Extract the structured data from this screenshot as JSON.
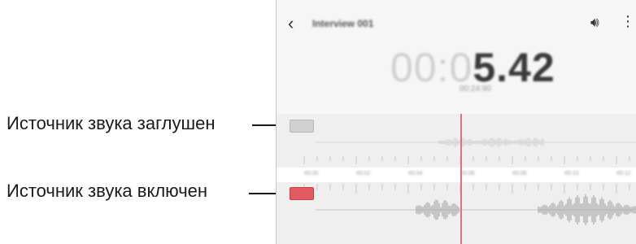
{
  "callouts": {
    "muted": "Источник звука заглушен",
    "enabled": "Источник звука включен"
  },
  "recorder": {
    "title": "Interview 001",
    "back_icon": "chevron-left-icon",
    "volume_icon": "speaker-icon",
    "more_icon": "more-vertical-icon",
    "elapsed_dim": "00:0",
    "elapsed_strong": "5.42",
    "total_time": "00:24:90",
    "timeline_marks": [
      "00:00",
      "00:02",
      "00:04",
      "00:06",
      "00:08",
      "00:10",
      "00:12"
    ],
    "colors": {
      "track_enabled": "#e05a60",
      "track_muted": "#d0d0d0",
      "playhead": "#e2717a"
    }
  }
}
